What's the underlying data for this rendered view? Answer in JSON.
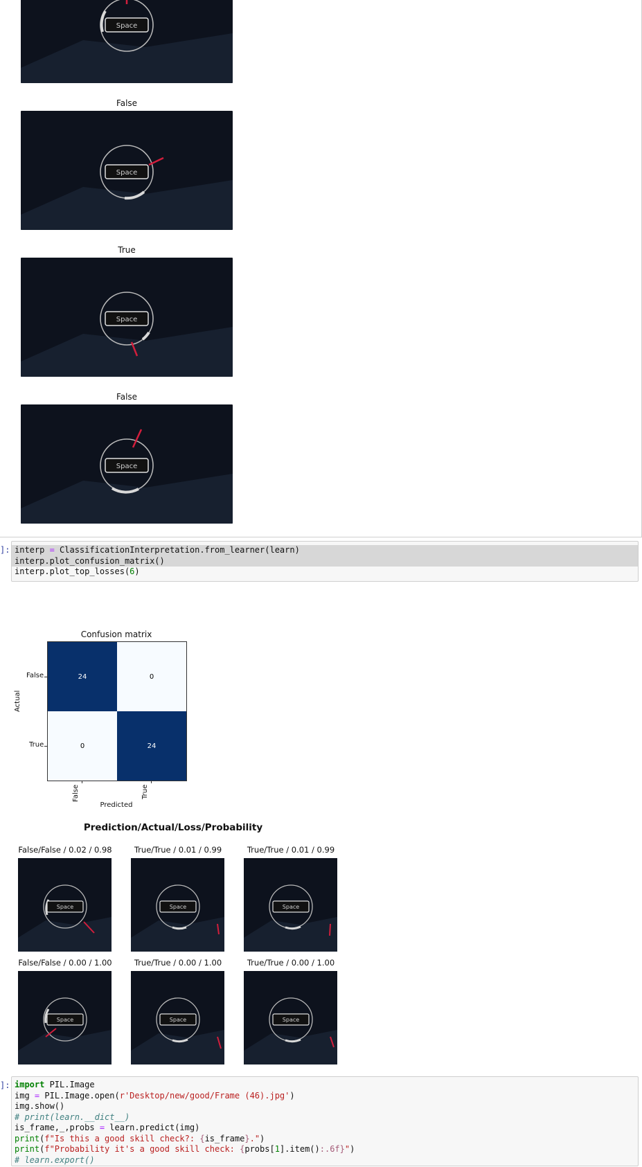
{
  "output_images": [
    {
      "title": "",
      "needle": "top"
    },
    {
      "title": "False",
      "needle": "right"
    },
    {
      "title": "True",
      "needle": "bottom"
    },
    {
      "title": "False",
      "needle": "upper-right"
    }
  ],
  "frame_button_text": "Space",
  "cell1": {
    "prompt": "]:",
    "lines": [
      "interp = ClassificationInterpretation.from_learner(learn)",
      "interp.plot_confusion_matrix()",
      "interp.plot_top_losses(6)"
    ]
  },
  "confusion": {
    "title": "Confusion matrix",
    "ylabel": "Actual",
    "xlabel": "Predicted",
    "row_labels": [
      "False",
      "True"
    ],
    "col_labels": [
      "False",
      "True"
    ],
    "values": [
      [
        24,
        0
      ],
      [
        0,
        24
      ]
    ],
    "colors": {
      "high": "#08306b",
      "low": "#f7fbff",
      "high_text": "#ffffff",
      "low_text": "#000000"
    }
  },
  "top_losses": {
    "title": "Prediction/Actual/Loss/Probability",
    "items": [
      {
        "label": "False/False / 0.02 / 0.98"
      },
      {
        "label": "True/True / 0.01 / 0.99"
      },
      {
        "label": "True/True / 0.01 / 0.99"
      },
      {
        "label": "False/False / 0.00 / 1.00"
      },
      {
        "label": "True/True / 0.00 / 1.00"
      },
      {
        "label": "True/True / 0.00 / 1.00"
      }
    ]
  },
  "cell2": {
    "prompt": "]:",
    "lines": [
      "import PIL.Image",
      "img = PIL.Image.open(r'Desktop/new/good/Frame (46).jpg')",
      "img.show()",
      "# print(learn.__dict__)",
      "is_frame,_,probs = learn.predict(img)",
      "print(f\"Is this a good skill check?: {is_frame}.\")",
      "print(f\"Probability it's a good skill check: {probs[1].item():.6f}\")",
      "# learn.export()"
    ]
  }
}
